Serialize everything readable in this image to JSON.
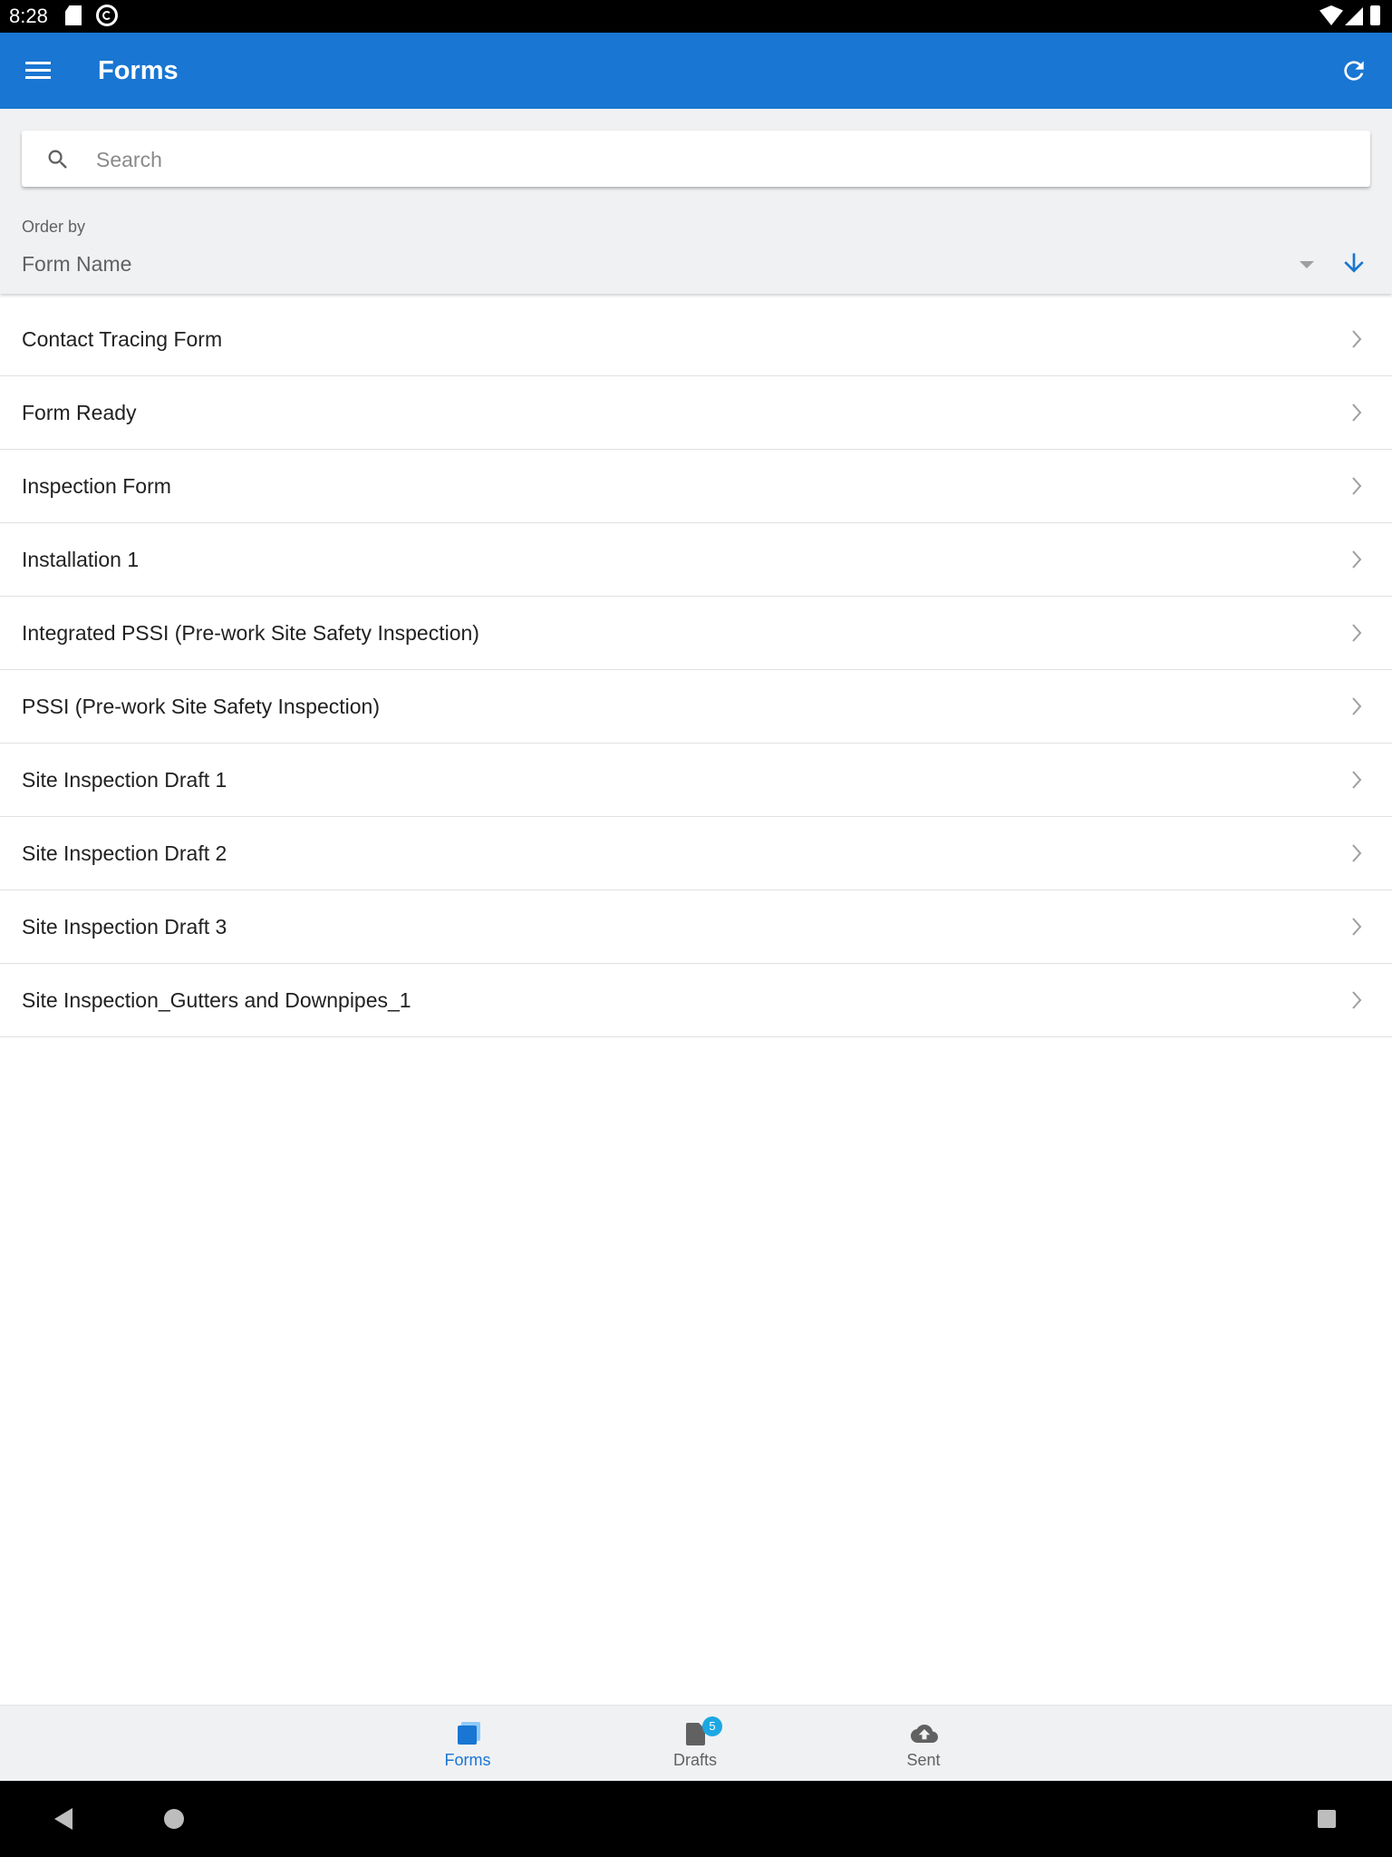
{
  "status_bar": {
    "time": "8:28"
  },
  "app_bar": {
    "title": "Forms"
  },
  "search": {
    "placeholder": "Search",
    "value": ""
  },
  "order": {
    "label": "Order by",
    "selected": "Form Name",
    "direction": "descending"
  },
  "forms": [
    {
      "name": "Contact Tracing Form"
    },
    {
      "name": "Form Ready"
    },
    {
      "name": "Inspection Form"
    },
    {
      "name": "Installation 1"
    },
    {
      "name": "Integrated PSSI (Pre-work Site Safety Inspection)"
    },
    {
      "name": "PSSI (Pre-work Site Safety Inspection)"
    },
    {
      "name": "Site Inspection Draft 1"
    },
    {
      "name": "Site Inspection Draft 2"
    },
    {
      "name": "Site Inspection Draft 3"
    },
    {
      "name": "Site Inspection_Gutters and Downpipes_1"
    }
  ],
  "bottom_nav": {
    "items": [
      {
        "label": "Forms",
        "icon": "forms-icon",
        "active": true
      },
      {
        "label": "Drafts",
        "icon": "drafts-icon",
        "badge": "5"
      },
      {
        "label": "Sent",
        "icon": "cloud-upload-icon"
      }
    ]
  },
  "colors": {
    "primary": "#1976d2",
    "badge": "#1ca8e3",
    "background": "#f0f1f3"
  }
}
